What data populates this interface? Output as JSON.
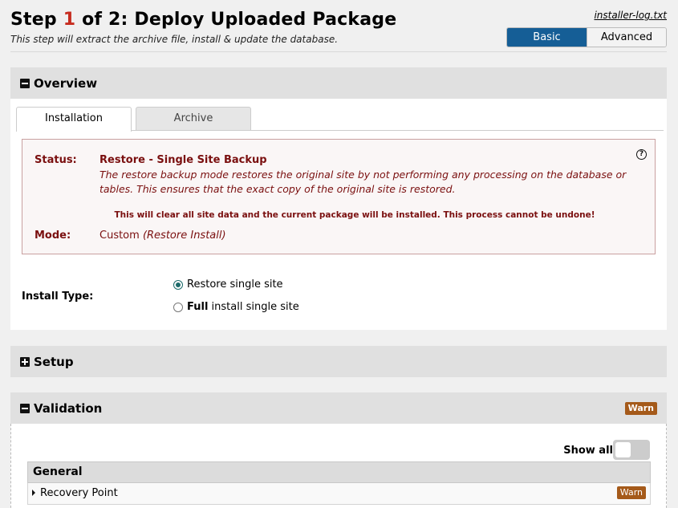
{
  "header": {
    "title_prefix": "Step",
    "title_step": "1",
    "title_suffix": "of 2: Deploy Uploaded Package",
    "subtitle": "This step will extract the archive file, install & update the database.",
    "log_link": "installer-log.txt",
    "mode_basic": "Basic",
    "mode_advanced": "Advanced"
  },
  "overview": {
    "title": "Overview",
    "tabs": [
      {
        "label": "Installation",
        "active": true
      },
      {
        "label": "Archive",
        "active": false
      }
    ],
    "status_label": "Status:",
    "status_title": "Restore - Single Site Backup",
    "status_desc": "The restore backup mode restores the original site by not performing any processing on the database or tables. This ensures that the exact copy of the original site is restored.",
    "warning": "This will clear all site data and the current package will be installed. This process cannot be undone!",
    "mode_label": "Mode:",
    "mode_value": "Custom",
    "mode_note": "(Restore Install)",
    "help_glyph": "?",
    "install_type_label": "Install Type:",
    "options": [
      {
        "label": "Restore single site",
        "selected": true
      },
      {
        "bold": "Full",
        "label": "install single site",
        "selected": false
      }
    ]
  },
  "setup": {
    "title": "Setup"
  },
  "validation": {
    "title": "Validation",
    "badge": "Warn",
    "show_all": "Show all",
    "group_title": "General",
    "items": [
      {
        "label": "Recovery Point",
        "badge": "Warn"
      }
    ]
  },
  "colors": {
    "accent": "#155e96",
    "step_number": "#c62c1f",
    "status_text": "#7a0f0f",
    "warn_badge": "#a55a1a"
  }
}
